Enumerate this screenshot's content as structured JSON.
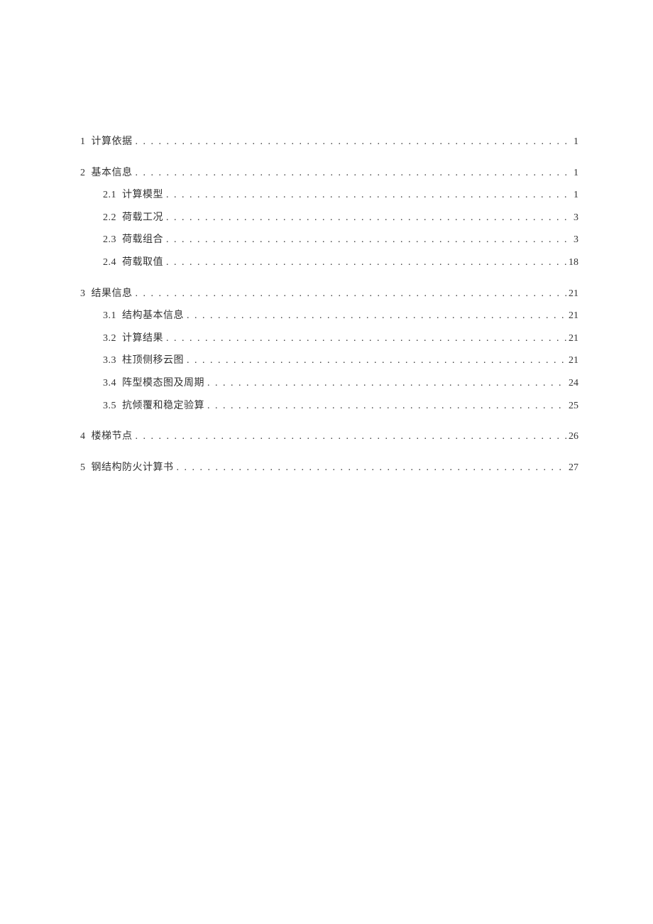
{
  "toc": {
    "entries": [
      {
        "level": 1,
        "num": "1",
        "title": "计算依据",
        "page": "1"
      },
      {
        "level": 1,
        "num": "2",
        "title": "基本信息",
        "page": "1"
      },
      {
        "level": 2,
        "num": "2.1",
        "title": "计算模型",
        "page": "1"
      },
      {
        "level": 2,
        "num": "2.2",
        "title": "荷载工况",
        "page": "3"
      },
      {
        "level": 2,
        "num": "2.3",
        "title": "荷载组合",
        "page": "3"
      },
      {
        "level": 2,
        "num": "2.4",
        "title": "荷载取值",
        "page": "18"
      },
      {
        "level": 1,
        "num": "3",
        "title": "结果信息",
        "page": "21"
      },
      {
        "level": 2,
        "num": "3.1",
        "title": "结构基本信息",
        "page": "21"
      },
      {
        "level": 2,
        "num": "3.2",
        "title": "计算结果",
        "page": "21"
      },
      {
        "level": 2,
        "num": "3.3",
        "title": "柱顶侧移云图",
        "page": "21"
      },
      {
        "level": 2,
        "num": "3.4",
        "title": "阵型模态图及周期",
        "page": "24"
      },
      {
        "level": 2,
        "num": "3.5",
        "title": "抗倾覆和稳定验算",
        "page": "25"
      },
      {
        "level": 1,
        "num": "4",
        "title": "楼梯节点",
        "page": "26"
      },
      {
        "level": 1,
        "num": "5",
        "title": "钢结构防火计算书",
        "page": "27"
      }
    ]
  }
}
